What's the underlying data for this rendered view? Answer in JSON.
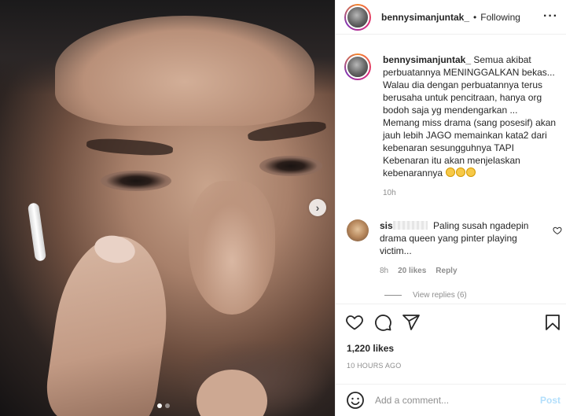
{
  "post": {
    "carousel": {
      "count": 2,
      "active_index": 0
    }
  },
  "header": {
    "username": "bennysimanjuntak_",
    "separator": "•",
    "follow_label": "Following",
    "more_icon": "more-horizontal-icon"
  },
  "caption": {
    "username": "bennysimanjuntak_",
    "text_lines": [
      "Semua akibat",
      "perbuatannya MENINGGALKAN bekas...",
      "Walau dia dengan perbuatannya terus",
      "berusaha untuk pencitraan, hanya org",
      "bodoh saja yg mendengarkan ...",
      "Memang miss drama (sang posesif) akan",
      "jauh lebih JAGO memainkan kata2 dari",
      "kebenaran sesungguhnya TAPI",
      "Kebenaran itu akan menjelaskan",
      "kebenarannya"
    ],
    "emojis": [
      "smiling-face-with-halo",
      "smiling-face-with-halo",
      "smiling-face-with-halo"
    ],
    "time": "10h"
  },
  "comment": {
    "user_visible": "sis",
    "text_lines": [
      "Paling susah ngadepin",
      "drama queen yang pinter playing",
      "victim..."
    ],
    "time": "8h",
    "likes": "20 likes",
    "reply_label": "Reply",
    "view_replies": "View replies (6)"
  },
  "actions": {
    "icons": [
      "heart-icon",
      "comment-icon",
      "share-icon",
      "bookmark-icon"
    ],
    "likes": "1,220 likes",
    "time_ago": "10 HOURS AGO"
  },
  "add_comment": {
    "placeholder": "Add a comment...",
    "post_label": "Post"
  },
  "colors": {
    "text": "#262626",
    "muted": "#8e8e8e",
    "post_disabled": "#b2dffc",
    "border": "#efefef"
  }
}
